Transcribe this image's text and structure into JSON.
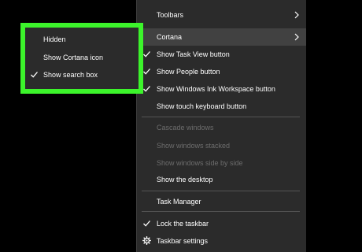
{
  "context_menu": {
    "items": [
      {
        "label": "Toolbars",
        "checked": false,
        "submenu": true,
        "disabled": false
      },
      {
        "label": "Cortana",
        "checked": false,
        "submenu": true,
        "disabled": false,
        "highlighted": true
      },
      {
        "label": "Show Task View button",
        "checked": true,
        "submenu": false,
        "disabled": false
      },
      {
        "label": "Show People button",
        "checked": true,
        "submenu": false,
        "disabled": false
      },
      {
        "label": "Show Windows Ink Workspace button",
        "checked": true,
        "submenu": false,
        "disabled": false
      },
      {
        "label": "Show touch keyboard button",
        "checked": false,
        "submenu": false,
        "disabled": false
      },
      {
        "label": "Cascade windows",
        "checked": false,
        "submenu": false,
        "disabled": true
      },
      {
        "label": "Show windows stacked",
        "checked": false,
        "submenu": false,
        "disabled": true
      },
      {
        "label": "Show windows side by side",
        "checked": false,
        "submenu": false,
        "disabled": true
      },
      {
        "label": "Show the desktop",
        "checked": false,
        "submenu": false,
        "disabled": false
      },
      {
        "label": "Task Manager",
        "checked": false,
        "submenu": false,
        "disabled": false
      },
      {
        "label": "Lock the taskbar",
        "checked": true,
        "submenu": false,
        "disabled": false
      },
      {
        "label": "Taskbar settings",
        "checked": false,
        "submenu": false,
        "disabled": false,
        "icon": "gear-icon"
      }
    ]
  },
  "cortana_submenu": {
    "items": [
      {
        "label": "Hidden",
        "checked": false
      },
      {
        "label": "Show Cortana icon",
        "checked": false
      },
      {
        "label": "Show search box",
        "checked": true
      }
    ]
  },
  "colors": {
    "menu_background": "#2b2b2b",
    "highlight_border": "#3cf42b",
    "hover_background": "#414141",
    "disabled_text": "#6d6d6d"
  }
}
